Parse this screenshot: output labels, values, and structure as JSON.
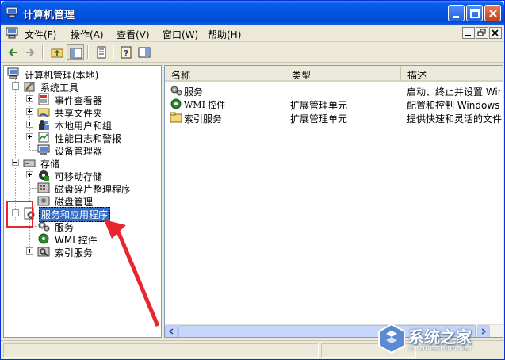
{
  "window": {
    "title": "计算机管理"
  },
  "menubar": {
    "items": [
      "文件(F)",
      "操作(A)",
      "查看(V)",
      "窗口(W)",
      "帮助(H)"
    ]
  },
  "tree": {
    "root": "计算机管理(本地)",
    "system_tools": "系统工具",
    "event_viewer": "事件查看器",
    "shared_folders": "共享文件夹",
    "local_users": "本地用户和组",
    "perf_logs": "性能日志和警报",
    "device_manager": "设备管理器",
    "storage": "存储",
    "removable_storage": "可移动存储",
    "defrag": "磁盘碎片整理程序",
    "disk_mgmt": "磁盘管理",
    "services_apps": "服务和应用程序",
    "services": "服务",
    "wmi": "WMI 控件",
    "indexing": "索引服务"
  },
  "list": {
    "columns": [
      "名称",
      "类型",
      "描述"
    ],
    "rows": [
      {
        "name": "服务",
        "type": "",
        "desc": "启动、终止并设置 Wir"
      },
      {
        "name": "WMI 控件",
        "type": "扩展管理单元",
        "desc": "配置和控制 Windows M"
      },
      {
        "name": "索引服务",
        "type": "扩展管理单元",
        "desc": "提供快速和灵活的文件"
      }
    ]
  },
  "watermark": {
    "text": "系统之家",
    "url": "XITONGZHIJIA.NET"
  },
  "colors": {
    "selection": "#316ac5",
    "annotation_red": "#e8262d",
    "titlebar_blue": "#0054e3"
  }
}
